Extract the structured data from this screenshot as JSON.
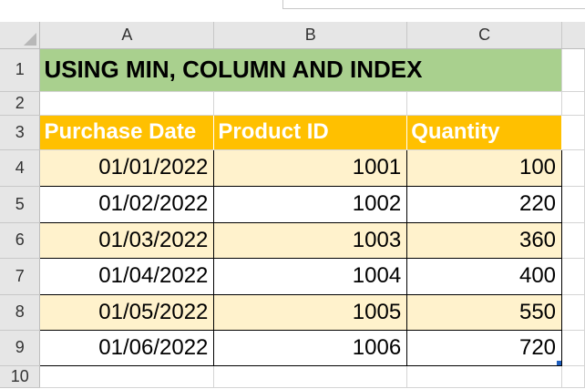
{
  "sheet": {
    "columns": [
      "A",
      "B",
      "C"
    ],
    "rows": [
      "1",
      "2",
      "3",
      "4",
      "5",
      "6",
      "7",
      "8",
      "9",
      "10"
    ],
    "title": "USING MIN, COLUMN AND INDEX",
    "headers": [
      "Purchase Date",
      "Product ID",
      "Quantity"
    ],
    "data": [
      [
        "01/01/2022",
        "1001",
        "100"
      ],
      [
        "01/02/2022",
        "1002",
        "220"
      ],
      [
        "01/03/2022",
        "1003",
        "360"
      ],
      [
        "01/04/2022",
        "1004",
        "400"
      ],
      [
        "01/05/2022",
        "1005",
        "550"
      ],
      [
        "01/06/2022",
        "1006",
        "720"
      ]
    ]
  },
  "colors": {
    "title_fill": "#a9d08e",
    "header_fill": "#ffc000",
    "band_fill": "#fff2cc",
    "selection": "#1f5fbf"
  }
}
